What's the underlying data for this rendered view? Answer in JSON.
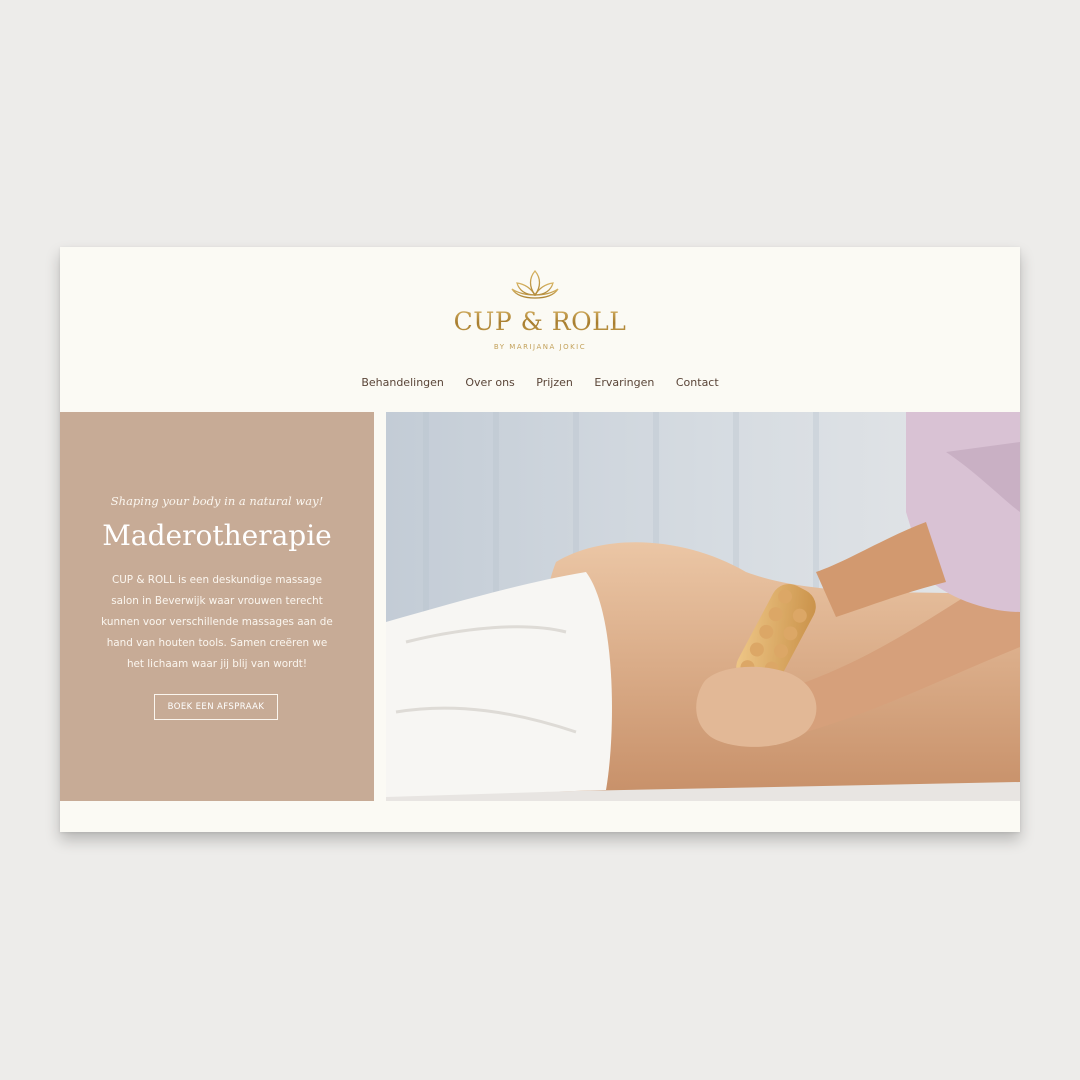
{
  "brand": {
    "name": "CUP & ROLL",
    "subtitle": "BY MARIJANA JOKIC",
    "icon": "lotus-icon",
    "color": "#b8913f"
  },
  "nav": {
    "items": [
      {
        "label": "Behandelingen"
      },
      {
        "label": "Over ons"
      },
      {
        "label": "Prijzen"
      },
      {
        "label": "Ervaringen"
      },
      {
        "label": "Contact"
      }
    ]
  },
  "hero": {
    "tagline": "Shaping your body in a natural way!",
    "title": "Maderotherapie",
    "text": "CUP & ROLL is een deskundige massage salon in Beverwijk waar vrouwen terecht kunnen voor verschillende massages aan de hand van houten tools. Samen creëren we het lichaam waar jij blij van wordt!",
    "button_label": "BOEK EEN AFSPRAAK",
    "panel_color": "#c7ab96",
    "image": "massage-photo"
  },
  "colors": {
    "background": "#edecea",
    "card": "#fbfaf4",
    "nav_text": "#5a4538"
  }
}
